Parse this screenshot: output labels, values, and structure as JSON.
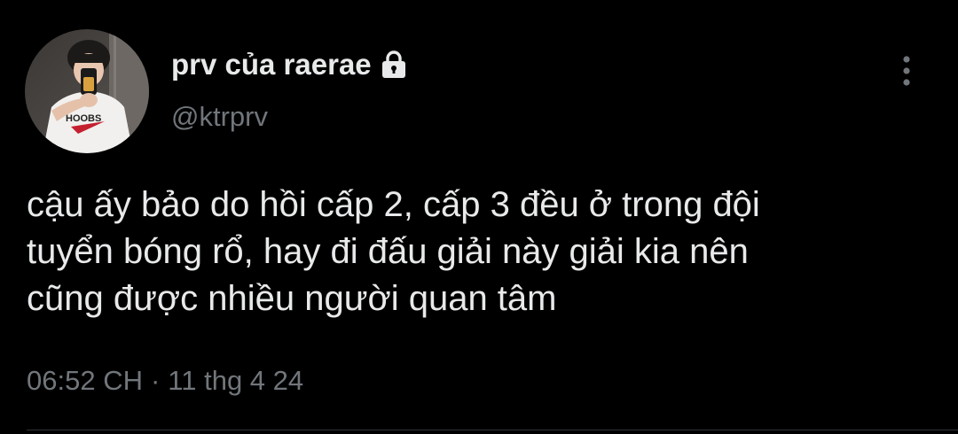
{
  "author": {
    "display_name": "prv của raerae",
    "handle": "@ktrprv",
    "protected_icon": "lock-icon",
    "avatar_image": "profile-photo"
  },
  "tweet": {
    "text": "cậu ấy bảo do hồi cấp 2, cấp 3 đều ở trong đội\ntuyển bóng rổ, hay đi đấu giải này giải kia nên\ncũng được nhiều người quan tâm",
    "time": "06:52 CH",
    "separator": "·",
    "date": "11 thg 4 24"
  },
  "menu": {
    "more_icon": "more-vertical-icon"
  },
  "colors": {
    "background": "#000000",
    "primary_text": "#e7e9ea",
    "secondary_text": "#71767b",
    "divider": "#2f3336"
  }
}
